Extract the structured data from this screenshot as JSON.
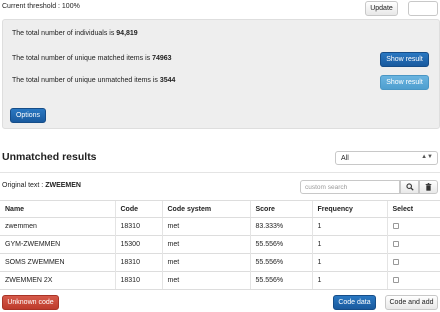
{
  "header": {
    "threshold_text": "Current threshold : 100%",
    "update_label": "Update"
  },
  "summary": {
    "individuals_prefix": "The total number of individuals is ",
    "individuals_value": "94,819",
    "matched_prefix": "The total number of unique matched items is ",
    "matched_value": "74963",
    "unmatched_prefix": "The total number of unique unmatched items is ",
    "unmatched_value": "3544",
    "show_result_label": "Show result",
    "options_label": "Options"
  },
  "unmatched": {
    "title": "Unmatched results",
    "filter_selected": "All",
    "original_prefix": "Original text : ",
    "original_value": "ZWEEMEN",
    "search_placeholder": "custom search",
    "columns": [
      "Name",
      "Code",
      "Code system",
      "Score",
      "Frequency",
      "Select"
    ],
    "rows": [
      {
        "name": "zwemmen",
        "code": "18310",
        "system": "met",
        "score": "83.333%",
        "frequency": "1"
      },
      {
        "name": "GYM-ZWEMMEN",
        "code": "15300",
        "system": "met",
        "score": "55.556%",
        "frequency": "1"
      },
      {
        "name": "SOMS ZWEMMEN",
        "code": "18310",
        "system": "met",
        "score": "55.556%",
        "frequency": "1"
      },
      {
        "name": "ZWEMMEN 2X",
        "code": "18310",
        "system": "met",
        "score": "55.556%",
        "frequency": "1"
      }
    ]
  },
  "footer": {
    "unknown_label": "Unknown code",
    "code_data_label": "Code data",
    "code_add_label": "Code and add"
  },
  "colors": {
    "primary": "#1a5a9e",
    "info": "#4f9fcf",
    "danger": "#bd3b2c",
    "panel": "#eeeeee"
  }
}
